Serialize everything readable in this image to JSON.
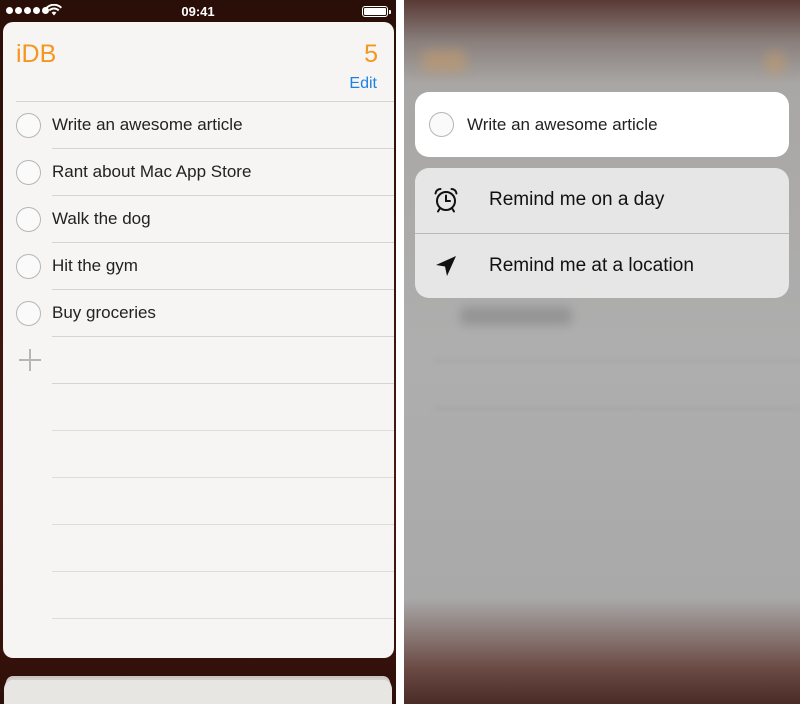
{
  "status_bar": {
    "time": "09:41"
  },
  "list": {
    "title": "iDB",
    "count": "5",
    "edit_label": "Edit",
    "items": [
      {
        "label": "Write an awesome article"
      },
      {
        "label": "Rant about Mac App Store"
      },
      {
        "label": "Walk the dog"
      },
      {
        "label": "Hit the gym"
      },
      {
        "label": "Buy groceries"
      }
    ]
  },
  "peek": {
    "item_label": "Write an awesome article"
  },
  "quick_actions": [
    {
      "label": "Remind me on a day",
      "icon": "alarm-clock-icon"
    },
    {
      "label": "Remind me at a location",
      "icon": "location-arrow-icon"
    }
  ],
  "colors": {
    "accent": "#f5961e",
    "link": "#1a82e2"
  }
}
